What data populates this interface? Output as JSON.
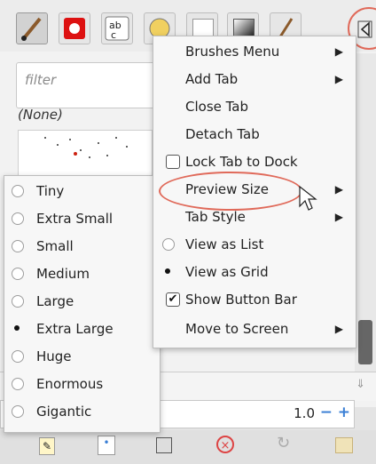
{
  "context_menu": {
    "items": [
      {
        "label": "Brushes Menu",
        "submenu": true
      },
      {
        "label": "Add Tab",
        "submenu": true
      },
      {
        "label": "Close Tab"
      },
      {
        "label": "Detach Tab"
      },
      {
        "label": "Lock Tab to Dock",
        "checkbox": false
      },
      {
        "label": "Preview Size",
        "submenu": true,
        "highlighted": true
      },
      {
        "label": "Tab Style",
        "submenu": true
      },
      {
        "label": "View as List",
        "radio": false
      },
      {
        "label": "View as Grid",
        "radio": true
      },
      {
        "label": "Show Button Bar",
        "checkbox": true
      },
      {
        "label": "Move to Screen",
        "submenu": true
      }
    ],
    "submenu_arrow": "▶"
  },
  "preview_size_menu": {
    "items": [
      {
        "label": "Tiny",
        "selected": false
      },
      {
        "label": "Extra Small",
        "selected": false
      },
      {
        "label": "Small",
        "selected": false
      },
      {
        "label": "Medium",
        "selected": false
      },
      {
        "label": "Large",
        "selected": false
      },
      {
        "label": "Extra Large",
        "selected": true
      },
      {
        "label": "Huge",
        "selected": false
      },
      {
        "label": "Enormous",
        "selected": false
      },
      {
        "label": "Gigantic",
        "selected": false
      }
    ]
  },
  "brushes_panel": {
    "filter_placeholder": "filter",
    "selected_label": "(None)",
    "size_value": "1.0",
    "size_minus": "−",
    "size_plus": "+"
  },
  "icons": {
    "tabs": [
      "paintbrush-icon",
      "pattern-icon",
      "text-icon",
      "gradient-icon",
      "white-swatch-icon",
      "dark-swatch-icon",
      "brush-icon",
      "tab-menu-icon"
    ],
    "toolbar": [
      "edit-icon",
      "new-icon",
      "duplicate-icon",
      "delete-icon",
      "refresh-icon",
      "open-as-image-icon"
    ]
  },
  "colors": {
    "highlight_ring": "#e06a5a",
    "menu_bg": "#f7f7f7",
    "accent": "#3a7fd5"
  }
}
